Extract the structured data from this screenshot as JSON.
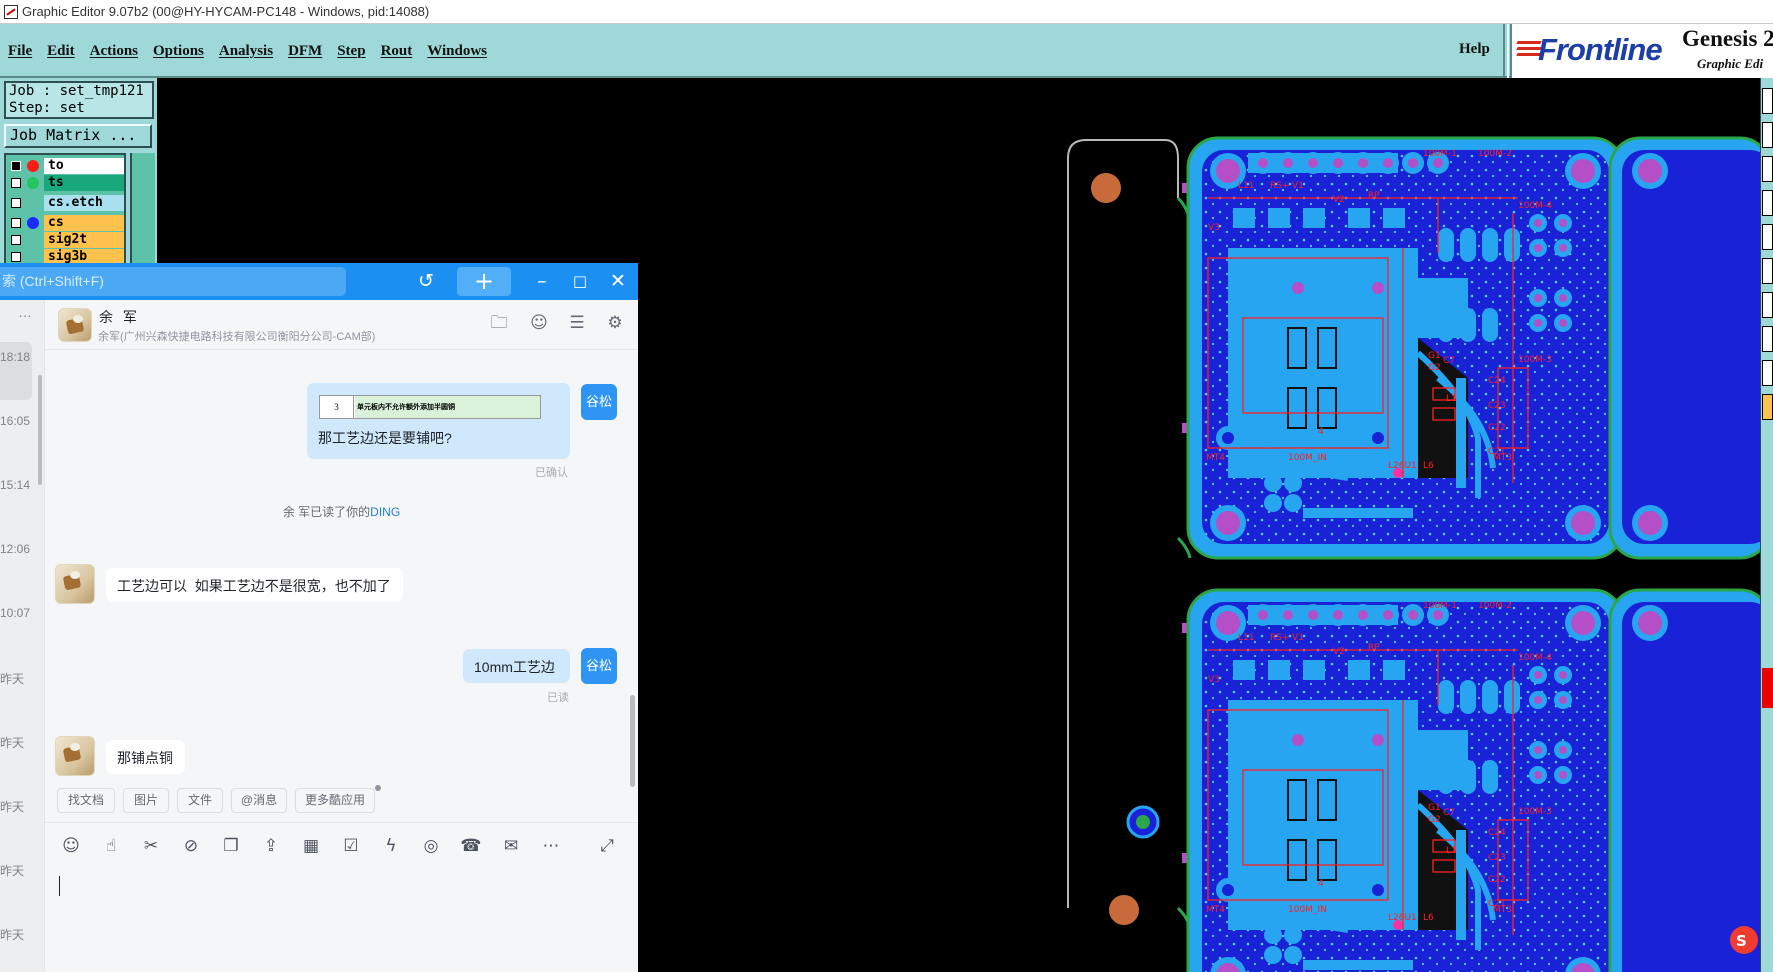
{
  "app": {
    "title": "Graphic Editor 9.07b2 (00@HY-HYCAM-PC148 - Windows, pid:14088)",
    "menus": [
      "File",
      "Edit",
      "Actions",
      "Options",
      "Analysis",
      "DFM",
      "Step",
      "Rout",
      "Windows"
    ],
    "help": "Help",
    "brand": {
      "logo": "Frontline",
      "product": "Genesis 2",
      "subtitle": "Graphic Edi"
    }
  },
  "job_panel": {
    "job": "Job : set_tmp121",
    "step": "Step: set",
    "matrix_button": "Job Matrix ...",
    "layers": [
      {
        "name": "to",
        "dot": "#ff1a1a",
        "bg": "#ffffff"
      },
      {
        "name": "ts",
        "dot": "#22c55e",
        "bg": "#19a77c"
      },
      {
        "name": "cs.etch",
        "dot": "",
        "bg": "#a8e0f0"
      },
      {
        "name": "cs",
        "dot": "#1a2bff",
        "bg": "#ffc34d"
      },
      {
        "name": "sig2t",
        "dot": "",
        "bg": "#ffc34d"
      },
      {
        "name": "sig3b",
        "dot": "",
        "bg": "#ffc34d"
      }
    ]
  },
  "colors": {
    "canvas": "#000000",
    "board_fill": "#1a22d8",
    "copper": "#27a5f0",
    "pad": "#b44fc8",
    "silkscreen": "#ff2020",
    "outline": "#2aa74a",
    "chat_accent": "#1c8ff2"
  },
  "chat": {
    "search_placeholder": "索 (Ctrl+Shift+F)",
    "contact": {
      "name": "余 军",
      "subtitle": "余军(广州兴森快捷电路科技有限公司衡阳分公司-CAM部)"
    },
    "session_times": [
      "18:18",
      "16:05",
      "15:14",
      "12:06",
      "10:07",
      "昨天",
      "昨天",
      "昨天",
      "昨天",
      "昨天"
    ],
    "messages": {
      "m1_image_cell": "3",
      "m1_image_text": "单元板内不允许额外添加半圆铜",
      "m1_text": "那工艺边还是要铺吧?",
      "m1_status": "已确认",
      "system_prefix": "余 军已读了你的",
      "system_ding": "DING",
      "m2_text": "工艺边可以  如果工艺边不是很宽，也不加了",
      "m3_text": "10mm工艺边",
      "m3_status": "已读",
      "m4_text": "那铺点铜",
      "sender_chip": "谷松"
    },
    "quick_actions": [
      "找文档",
      "图片",
      "文件",
      "@消息",
      "更多酷应用"
    ],
    "toolbar_icons": [
      "emoji-icon",
      "thumbs-up-icon",
      "scissors-icon",
      "slash-command-icon",
      "doc-add-icon",
      "upload-icon",
      "calendar-icon",
      "task-check-icon",
      "ding-bolt-icon",
      "video-call-icon",
      "phone-call-icon",
      "mail-icon",
      "more-icon"
    ]
  }
}
